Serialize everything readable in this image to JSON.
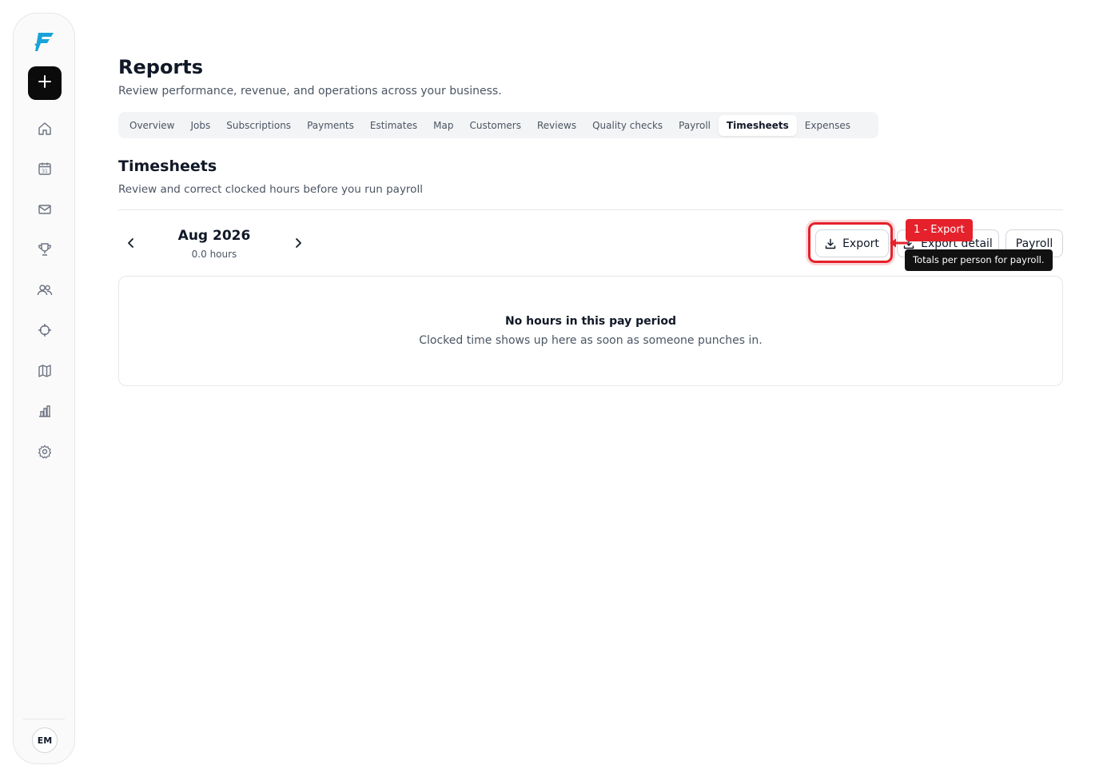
{
  "sidebar": {
    "logo_icon": "brand-logo-icon",
    "add_icon": "plus-icon",
    "nav_icons": [
      "home-icon",
      "calendar-icon",
      "mail-icon",
      "trophy-icon",
      "users-icon",
      "crosshair-icon",
      "map-icon",
      "bar-chart-icon",
      "gear-icon"
    ],
    "calendar_day": "31",
    "avatar_initials": "EM"
  },
  "header": {
    "title": "Reports",
    "subtitle": "Review performance, revenue, and operations across your business."
  },
  "tabs": [
    {
      "label": "Overview"
    },
    {
      "label": "Jobs"
    },
    {
      "label": "Subscriptions"
    },
    {
      "label": "Payments"
    },
    {
      "label": "Estimates"
    },
    {
      "label": "Map"
    },
    {
      "label": "Customers"
    },
    {
      "label": "Reviews"
    },
    {
      "label": "Quality checks"
    },
    {
      "label": "Payroll"
    },
    {
      "label": "Timesheets",
      "active": true
    },
    {
      "label": "Expenses"
    }
  ],
  "section": {
    "title": "Timesheets",
    "subtitle": "Review and correct clocked hours before you run payroll"
  },
  "period": {
    "month": "Aug 2026",
    "hours": "0.0 hours"
  },
  "actions": {
    "export_label": "Export",
    "export_detail_label": "Export detail",
    "payroll_label": "Payroll"
  },
  "annotation": {
    "label": "1 - Export",
    "tooltip": "Totals per person for payroll."
  },
  "empty_state": {
    "title": "No hours in this pay period",
    "description": "Clocked time shows up here as soon as someone punches in."
  },
  "colors": {
    "annotation_red": "#e5212b",
    "brand_blue": "#1aa3d9",
    "primary_dark": "#0b0b0b"
  }
}
